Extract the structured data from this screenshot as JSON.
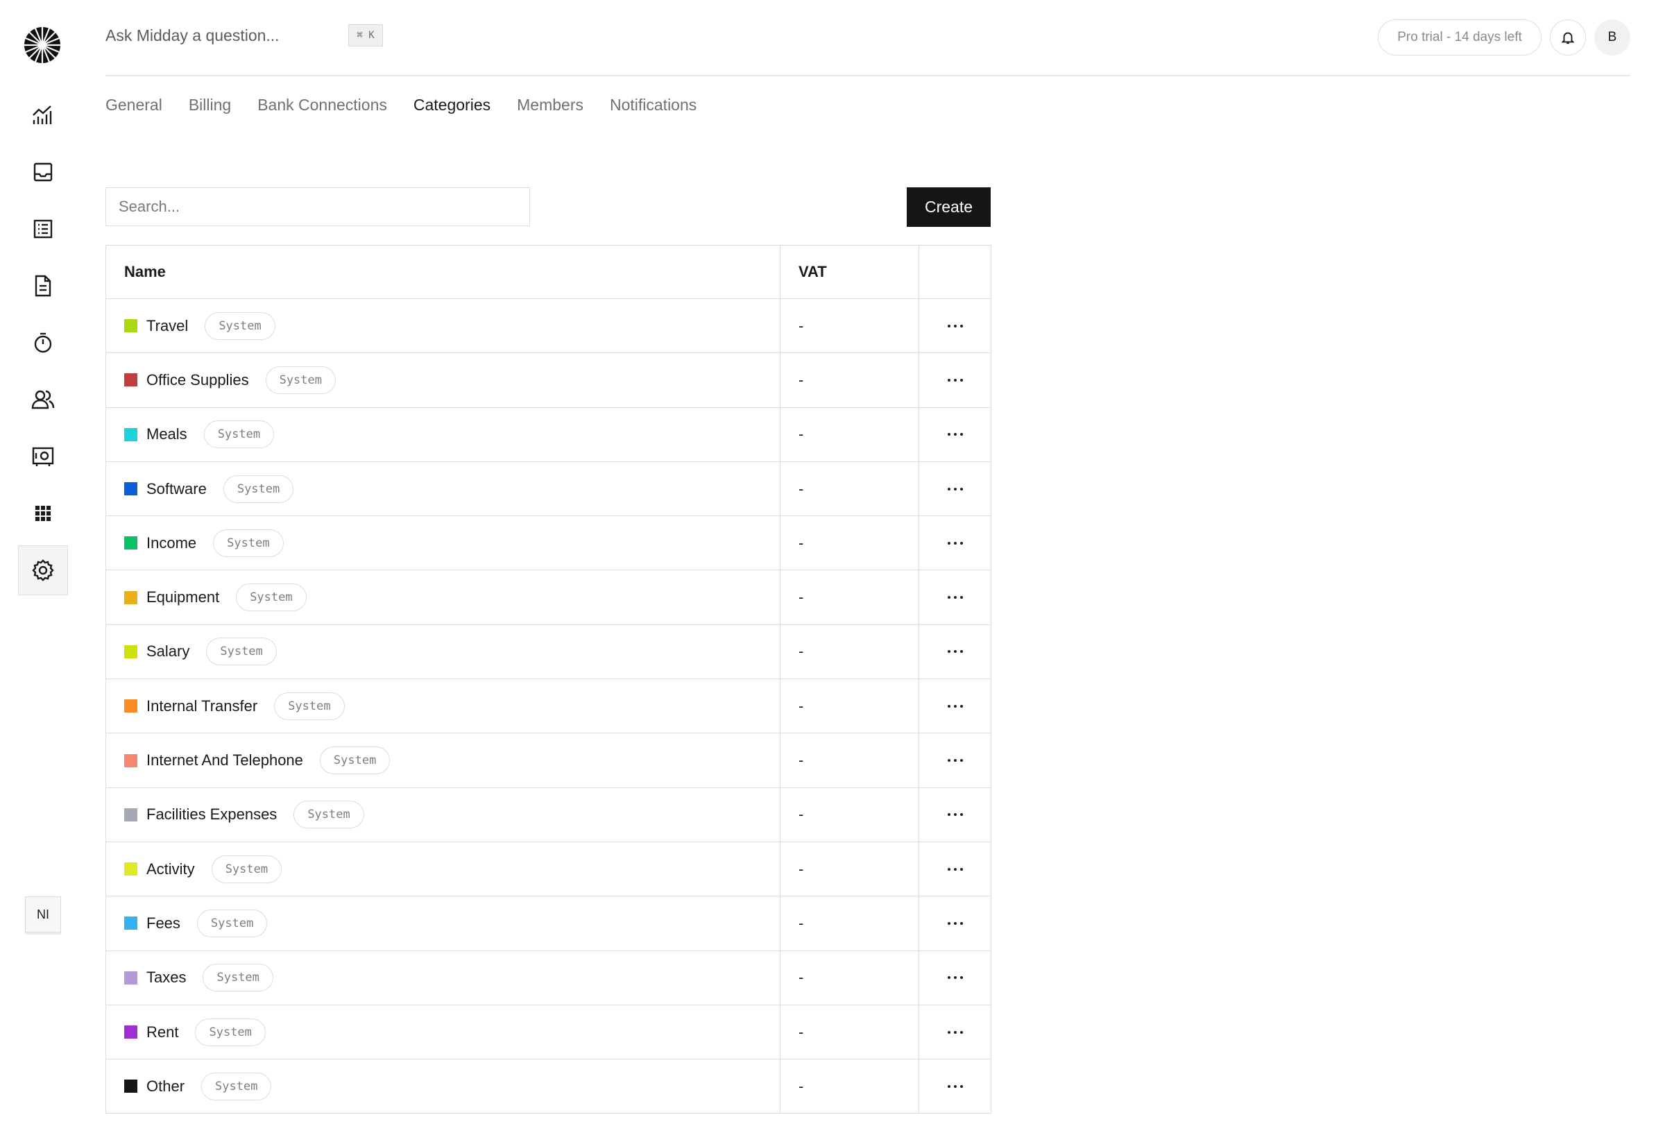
{
  "header": {
    "ask_placeholder": "Ask Midday a question...",
    "shortcut": "⌘ K",
    "trial_badge": "Pro trial - 14 days left",
    "avatar_initial": "B"
  },
  "sidebar": {
    "items": [
      {
        "name": "overview",
        "icon": "chart-icon"
      },
      {
        "name": "inbox",
        "icon": "inbox-icon"
      },
      {
        "name": "transactions",
        "icon": "list-icon"
      },
      {
        "name": "invoices",
        "icon": "document-icon"
      },
      {
        "name": "tracker",
        "icon": "timer-icon"
      },
      {
        "name": "customers",
        "icon": "users-icon"
      },
      {
        "name": "vault",
        "icon": "vault-icon"
      },
      {
        "name": "apps",
        "icon": "grid-icon"
      },
      {
        "name": "settings",
        "icon": "gear-icon",
        "active": true
      }
    ],
    "bottom_badge": "NI"
  },
  "tabs": [
    "General",
    "Billing",
    "Bank Connections",
    "Categories",
    "Members",
    "Notifications"
  ],
  "active_tab": "Categories",
  "search": {
    "placeholder": "Search..."
  },
  "create_label": "Create",
  "table": {
    "headers": {
      "name": "Name",
      "vat": "VAT"
    },
    "rows": [
      {
        "name": "Travel",
        "color": "#abd80e",
        "tag": "System",
        "vat": "-"
      },
      {
        "name": "Office Supplies",
        "color": "#bd3f3f",
        "tag": "System",
        "vat": "-"
      },
      {
        "name": "Meals",
        "color": "#1cd3d9",
        "tag": "System",
        "vat": "-"
      },
      {
        "name": "Software",
        "color": "#0b5ed7",
        "tag": "System",
        "vat": "-"
      },
      {
        "name": "Income",
        "color": "#0bc166",
        "tag": "System",
        "vat": "-"
      },
      {
        "name": "Equipment",
        "color": "#e8b01a",
        "tag": "System",
        "vat": "-"
      },
      {
        "name": "Salary",
        "color": "#cfe00b",
        "tag": "System",
        "vat": "-"
      },
      {
        "name": "Internal Transfer",
        "color": "#fa8a22",
        "tag": "System",
        "vat": "-"
      },
      {
        "name": "Internet And Telephone",
        "color": "#f58772",
        "tag": "System",
        "vat": "-"
      },
      {
        "name": "Facilities Expenses",
        "color": "#a5a8b5",
        "tag": "System",
        "vat": "-"
      },
      {
        "name": "Activity",
        "color": "#e0ea24",
        "tag": "System",
        "vat": "-"
      },
      {
        "name": "Fees",
        "color": "#34b2f0",
        "tag": "System",
        "vat": "-"
      },
      {
        "name": "Taxes",
        "color": "#b499d8",
        "tag": "System",
        "vat": "-"
      },
      {
        "name": "Rent",
        "color": "#9f2fd0",
        "tag": "System",
        "vat": "-"
      },
      {
        "name": "Other",
        "color": "#151515",
        "tag": "System",
        "vat": "-"
      }
    ]
  }
}
